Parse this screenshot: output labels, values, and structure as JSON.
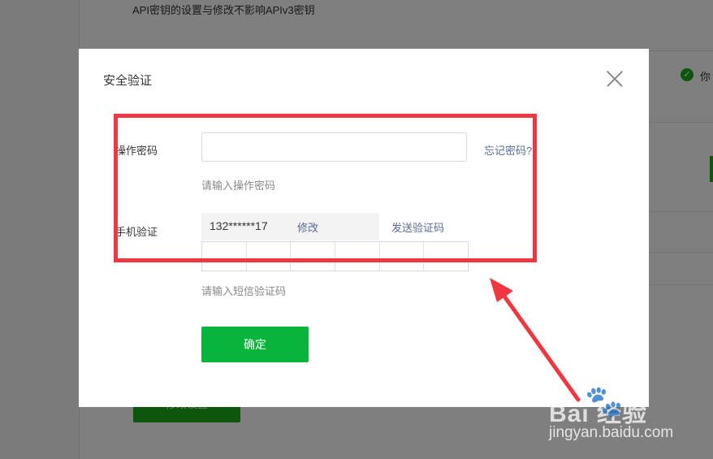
{
  "background": {
    "note": "API密钥的设置与修改不影响APIv3密钥",
    "right_text": "你",
    "button_label": "修改设置"
  },
  "modal": {
    "title": "安全验证",
    "password": {
      "label": "操作密码",
      "value": "",
      "forgot_link": "忘记密码?",
      "hint": "请输入操作密码"
    },
    "phone": {
      "label": "手机验证",
      "number": "132******17",
      "modify_link": "修改",
      "send_code_link": "发送验证码",
      "code_cells": [
        "",
        "",
        "",
        "",
        "",
        ""
      ],
      "hint": "请输入短信验证码"
    },
    "confirm_label": "确定"
  },
  "annotation": {
    "color": "#f0373f"
  },
  "watermark": {
    "brand": "Bai  经验",
    "url": "jingyan.baidu.com"
  },
  "colors": {
    "accent_green": "#07b53b",
    "link_blue": "#576b95"
  }
}
